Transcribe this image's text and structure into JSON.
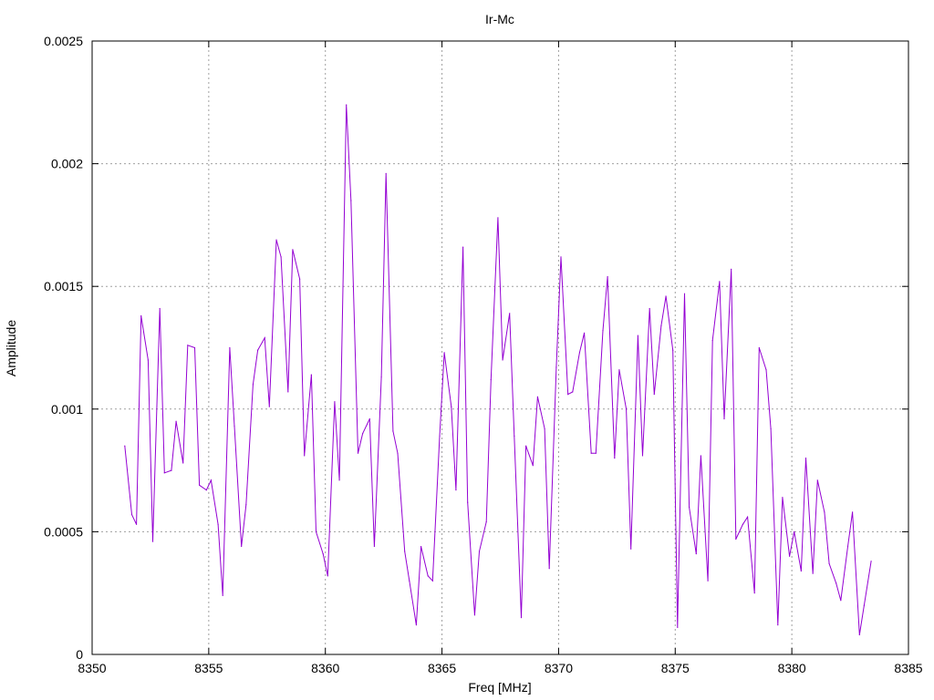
{
  "chart_data": {
    "type": "line",
    "title": "Ir-Mc",
    "xlabel": "Freq [MHz]",
    "ylabel": "Amplitude",
    "xlim": [
      8350,
      8385
    ],
    "ylim": [
      0,
      0.0025
    ],
    "x_ticks": [
      "8350",
      "8355",
      "8360",
      "8365",
      "8370",
      "8375",
      "8380",
      "8385"
    ],
    "y_ticks": [
      "0",
      "0.0005",
      "0.001",
      "0.0015",
      "0.002",
      "0.0025"
    ],
    "grid": true,
    "line_color": "#9400d3",
    "series": [
      {
        "x": [
          8351.4,
          8351.7,
          8351.9,
          8352.1,
          8352.4,
          8352.6,
          8352.9,
          8353.1,
          8353.4,
          8353.6,
          8353.9,
          8354.1,
          8354.4,
          8354.6,
          8354.9,
          8355.1,
          8355.4,
          8355.6,
          8355.9,
          8356.1,
          8356.4,
          8356.6,
          8356.9,
          8357.1,
          8357.4,
          8357.6,
          8357.9,
          8358.1,
          8358.4,
          8358.6,
          8358.9,
          8359.1,
          8359.4,
          8359.6,
          8359.9,
          8360.1,
          8360.4,
          8360.6,
          8360.9,
          8361.1,
          8361.4,
          8361.6,
          8361.9,
          8362.1,
          8362.4,
          8362.6,
          8362.9,
          8363.1,
          8363.4,
          8363.6,
          8363.9,
          8364.1,
          8364.4,
          8364.6,
          8364.9,
          8365.1,
          8365.4,
          8365.6,
          8365.9,
          8366.1,
          8366.4,
          8366.6,
          8366.9,
          8367.1,
          8367.4,
          8367.6,
          8367.9,
          8368.1,
          8368.4,
          8368.6,
          8368.9,
          8369.1,
          8369.4,
          8369.6,
          8369.9,
          8370.1,
          8370.4,
          8370.6,
          8370.9,
          8371.1,
          8371.4,
          8371.6,
          8371.9,
          8372.1,
          8372.4,
          8372.6,
          8372.9,
          8373.1,
          8373.4,
          8373.6,
          8373.9,
          8374.1,
          8374.4,
          8374.6,
          8374.9,
          8375.1,
          8375.4,
          8375.6,
          8375.9,
          8376.1,
          8376.4,
          8376.6,
          8376.9,
          8377.1,
          8377.4,
          8377.6,
          8377.9,
          8378.1,
          8378.4,
          8378.6,
          8378.9,
          8379.1,
          8379.4,
          8379.6,
          8379.9,
          8380.1,
          8380.4,
          8380.6,
          8380.9,
          8381.1,
          8381.4,
          8381.6,
          8381.9,
          8382.1,
          8382.4,
          8382.6,
          8382.9,
          8383.1,
          8383.4
        ],
        "values": [
          0.00085,
          0.00057,
          0.00053,
          0.00138,
          0.0012,
          0.00046,
          0.00141,
          0.00074,
          0.00075,
          0.00095,
          0.00078,
          0.00126,
          0.00125,
          0.00069,
          0.00067,
          0.00071,
          0.00053,
          0.00024,
          0.00125,
          0.00093,
          0.00044,
          0.00061,
          0.0011,
          0.00124,
          0.00129,
          0.00101,
          0.00169,
          0.00162,
          0.00107,
          0.00165,
          0.00153,
          0.00081,
          0.00114,
          0.0005,
          0.00041,
          0.00032,
          0.00103,
          0.00071,
          0.00224,
          0.00185,
          0.00082,
          0.0009,
          0.00096,
          0.00044,
          0.00113,
          0.00196,
          0.00091,
          0.00082,
          0.00042,
          0.0003,
          0.00012,
          0.00044,
          0.00032,
          0.0003,
          0.00089,
          0.00123,
          0.00101,
          0.00067,
          0.00166,
          0.00062,
          0.00016,
          0.00042,
          0.00054,
          0.00112,
          0.00178,
          0.0012,
          0.00139,
          0.00089,
          0.00015,
          0.00085,
          0.00077,
          0.00105,
          0.00092,
          0.00035,
          0.00117,
          0.00162,
          0.00106,
          0.00107,
          0.00123,
          0.00131,
          0.00082,
          0.00082,
          0.00132,
          0.00154,
          0.0008,
          0.00116,
          0.001,
          0.00043,
          0.0013,
          0.00081,
          0.00141,
          0.00106,
          0.00134,
          0.00146,
          0.00124,
          0.00011,
          0.00147,
          0.0006,
          0.00041,
          0.00081,
          0.0003,
          0.00128,
          0.00152,
          0.00096,
          0.00157,
          0.00047,
          0.00053,
          0.00056,
          0.00025,
          0.00125,
          0.00116,
          0.00092,
          0.00012,
          0.00064,
          0.0004,
          0.0005,
          0.00034,
          0.0008,
          0.00033,
          0.00071,
          0.00058,
          0.00037,
          0.00029,
          0.00022,
          0.00044,
          0.00058,
          8e-05,
          0.0002,
          0.00038
        ]
      }
    ]
  }
}
